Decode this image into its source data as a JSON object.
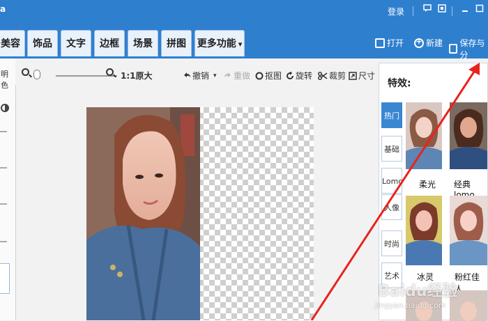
{
  "titlebar": {
    "title_fragment": "a",
    "login": "登录",
    "icons": [
      "feedback-icon",
      "skin-icon",
      "minimize-icon",
      "maximize-icon"
    ]
  },
  "tabs": [
    {
      "label": "美容"
    },
    {
      "label": "饰品"
    },
    {
      "label": "文字"
    },
    {
      "label": "边框"
    },
    {
      "label": "场景"
    },
    {
      "label": "拼图"
    },
    {
      "label": "更多功能"
    }
  ],
  "file_actions": {
    "open": "打开",
    "new": "新建",
    "save": "保存与分"
  },
  "left_panel": {
    "label": "明色"
  },
  "edit_toolbar": {
    "original_size": "1:1原大",
    "undo": "撤销",
    "redo": "重做",
    "crop_icon_label": "抠图",
    "rotate": "旋转",
    "cut": "裁剪",
    "resize": "尺寸"
  },
  "effects": {
    "title": "特效:",
    "categories": [
      "热门",
      "基础",
      "Lomo",
      "人像",
      "时尚",
      "艺术"
    ],
    "active_category": "热门",
    "presets": [
      "柔光",
      "经典lomo",
      "冰灵",
      "粉红佳人"
    ]
  },
  "watermark": "Baidu经验",
  "watermark_url": "jingyan.baidu.com",
  "colors": {
    "brand_blue": "#2f7fcf",
    "active_tab": "#3a86d3",
    "arrow": "#e8231c"
  }
}
